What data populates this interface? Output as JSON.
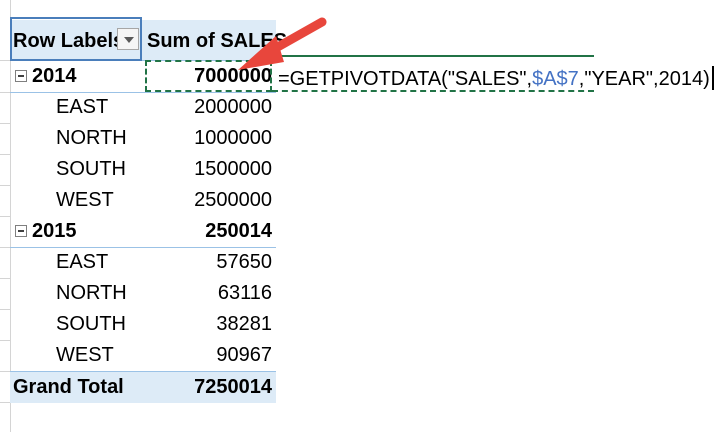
{
  "pivot": {
    "header": {
      "row_labels": "Row Labels",
      "sum_label": "Sum of SALES"
    },
    "groups": [
      {
        "year": "2014",
        "total": "7000000",
        "items": [
          {
            "region": "EAST",
            "value": "2000000"
          },
          {
            "region": "NORTH",
            "value": "1000000"
          },
          {
            "region": "SOUTH",
            "value": "1500000"
          },
          {
            "region": "WEST",
            "value": "2500000"
          }
        ]
      },
      {
        "year": "2015",
        "total": "250014",
        "items": [
          {
            "region": "EAST",
            "value": "57650"
          },
          {
            "region": "NORTH",
            "value": "63116"
          },
          {
            "region": "SOUTH",
            "value": "38281"
          },
          {
            "region": "WEST",
            "value": "90967"
          }
        ]
      }
    ],
    "grand_total": {
      "label": "Grand Total",
      "value": "7250014"
    }
  },
  "formula": {
    "prefix": "=GETPIVOTDATA(\"SALES\",",
    "ref": "$A$7",
    "suffix": ",\"YEAR\",2014)"
  },
  "colors": {
    "header_fill": "#ddebf7",
    "selection_border": "#217346",
    "cell_ref": "#4472c4",
    "arrow": "#e8463c"
  },
  "icons": {
    "filter": "dropdown-arrow-icon",
    "collapse": "collapse-minus-icon",
    "pointer": "red-arrow-icon"
  }
}
